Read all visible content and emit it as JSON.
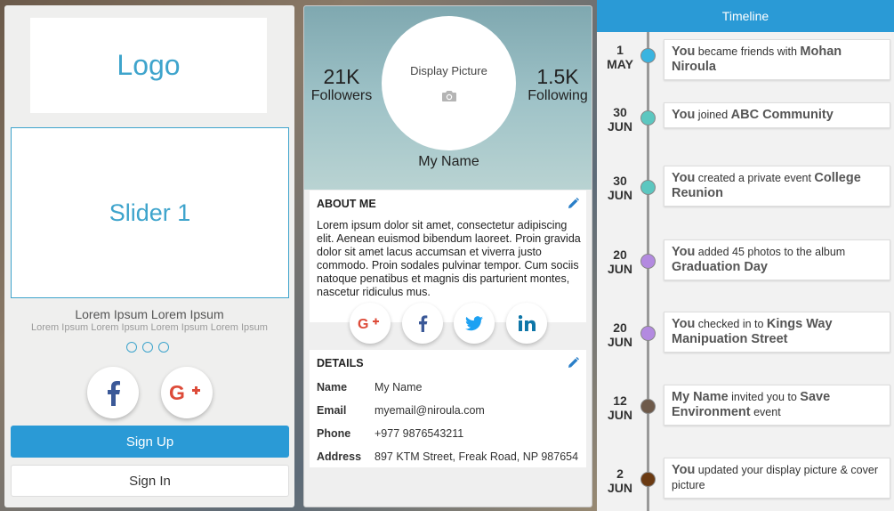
{
  "login": {
    "logo": "Logo",
    "slider": "Slider 1",
    "title": "Lorem Ipsum Lorem Ipsum",
    "subtitle": "Lorem Ipsum Lorem Ipsum Lorem Ipsum Lorem Ipsum",
    "facebook_icon": "facebook-icon",
    "google_icon": "google-plus-icon",
    "signup": "Sign Up",
    "signin": "Sign In"
  },
  "profile": {
    "followers_count": "21K",
    "followers_label": "Followers",
    "following_count": "1.5K",
    "following_label": "Following",
    "display_picture": "Display Picture",
    "name": "My Name",
    "about_title": "ABOUT ME",
    "about_text": "Lorem ipsum dolor sit amet, consectetur adipiscing elit. Aenean euismod bibendum laoreet. Proin gravida dolor sit amet lacus accumsan et viverra justo commodo. Proin sodales pulvinar tempor. Cum sociis natoque penatibus et magnis dis parturient montes, nascetur ridiculus mus.",
    "details_title": "DETAILS",
    "details": [
      {
        "label": "Name",
        "value": "My Name"
      },
      {
        "label": "Email",
        "value": "myemail@niroula.com"
      },
      {
        "label": "Phone",
        "value": "+977 9876543211"
      },
      {
        "label": "Address",
        "value": "897 KTM Street, Freak Road, NP 987654"
      }
    ]
  },
  "timeline": {
    "title": "Timeline",
    "items": [
      {
        "day": "1",
        "month": "MAY",
        "dot": "#3ab4e0",
        "who": "You",
        "pre": " became friends with ",
        "obj": "Mohan Niroula",
        "post": ""
      },
      {
        "day": "30",
        "month": "JUN",
        "dot": "#5cc7c0",
        "who": "You",
        "pre": " joined ",
        "obj": "ABC Community",
        "post": ""
      },
      {
        "day": "30",
        "month": "JUN",
        "dot": "#5cc7c0",
        "who": "You",
        "pre": " created a private event ",
        "obj": "College Reunion",
        "post": ""
      },
      {
        "day": "20",
        "month": "JUN",
        "dot": "#b38ae0",
        "who": "You",
        "pre": " added 45 photos to the album ",
        "obj": "Graduation Day",
        "post": ""
      },
      {
        "day": "20",
        "month": "JUN",
        "dot": "#b38ae0",
        "who": "You",
        "pre": " checked in to ",
        "obj": "Kings Way Manipuation Street",
        "post": ""
      },
      {
        "day": "12",
        "month": "JUN",
        "dot": "#6e5a4a",
        "who": "My Name",
        "pre": " invited you to ",
        "obj": "Save Environment",
        "post": " event"
      },
      {
        "day": "2",
        "month": "JUN",
        "dot": "#6b3a12",
        "who": "You",
        "pre": " updated your display picture & cover picture",
        "obj": "",
        "post": ""
      }
    ]
  }
}
